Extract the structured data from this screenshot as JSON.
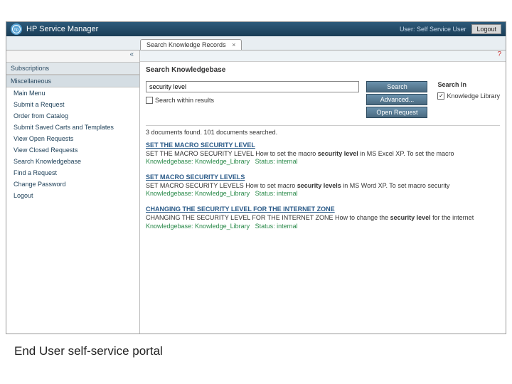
{
  "header": {
    "app_title": "HP Service Manager",
    "user_label": "User: Self Service User",
    "logout": "Logout"
  },
  "tab": {
    "label": "Search Knowledge Records"
  },
  "sidebar": {
    "sections": {
      "subscriptions": "Subscriptions",
      "miscellaneous": "Miscellaneous"
    },
    "items": [
      "Main Menu",
      "Submit a Request",
      "Order from Catalog",
      "Submit Saved Carts and Templates",
      "View Open Requests",
      "View Closed Requests",
      "Search Knowledgebase",
      "Find a Request",
      "Change Password",
      "Logout"
    ]
  },
  "search": {
    "heading": "Search Knowledgebase",
    "value": "security level",
    "within": "Search within results",
    "buttons": {
      "search": "Search",
      "advanced": "Advanced...",
      "open": "Open Request"
    },
    "search_in_label": "Search In",
    "library": "Knowledge Library"
  },
  "results": {
    "summary": "3 documents found. 101 documents searched.",
    "items": [
      {
        "title": "SET THE MACRO SECURITY LEVEL",
        "body_pre": "SET THE MACRO SECURITY LEVEL How to set the macro ",
        "body_bold": "security level",
        "body_post": " in MS Excel XP. To set the macro",
        "kb": "Knowledgebase: Knowledge_Library",
        "status": "Status: internal"
      },
      {
        "title": "SET MACRO SECURITY LEVELS",
        "body_pre": "SET MACRO SECURITY LEVELS How to set macro ",
        "body_bold": "security levels",
        "body_post": " in MS Word XP. To set macro security",
        "kb": "Knowledgebase: Knowledge_Library",
        "status": "Status: internal"
      },
      {
        "title": "CHANGING THE SECURITY LEVEL FOR THE INTERNET ZONE",
        "body_pre": "CHANGING THE SECURITY LEVEL FOR THE INTERNET ZONE How to change the ",
        "body_bold": "security level",
        "body_post": " for the internet",
        "kb": "Knowledgebase: Knowledge_Library",
        "status": "Status: internal"
      }
    ]
  },
  "caption": "End User self-service portal"
}
